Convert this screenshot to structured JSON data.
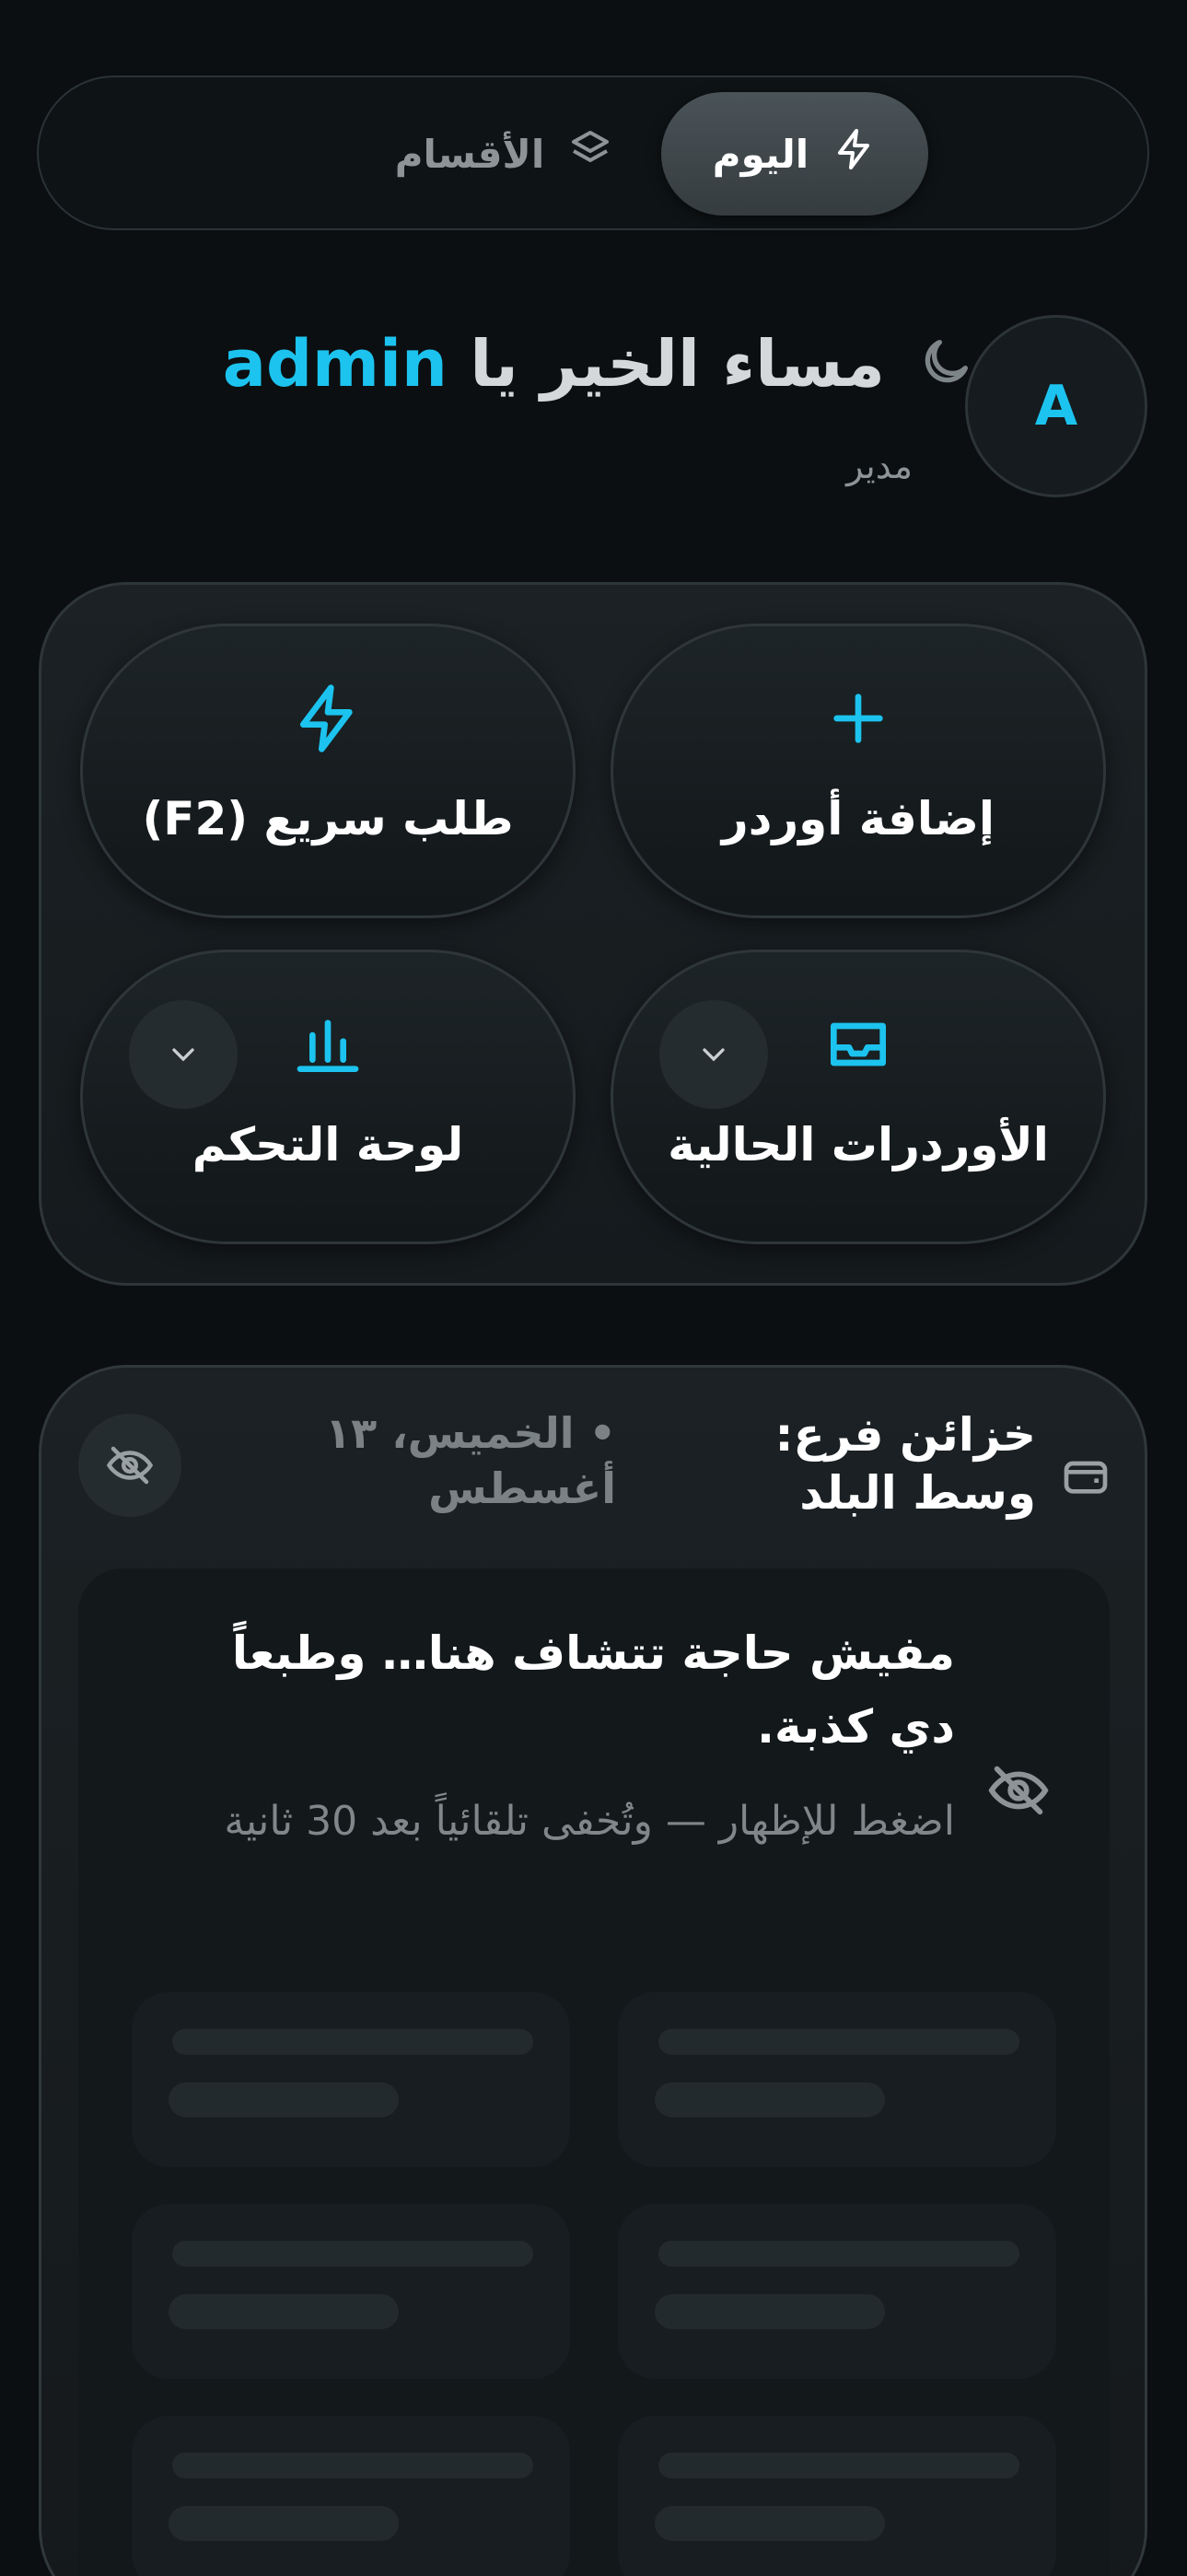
{
  "tabs": {
    "today_label": "اليوم",
    "today_icon": "bolt-icon",
    "sections_label": "الأقسام",
    "sections_icon": "layers-icon"
  },
  "header": {
    "greeting": "مساء الخير يا",
    "username": "admin",
    "role": "مدير",
    "avatar_letter": "A",
    "time_icon": "moon-icon"
  },
  "actions": [
    {
      "label": "إضافة أوردر",
      "icon": "plus-icon"
    },
    {
      "label": "طلب سريع (F2)",
      "icon": "bolt-icon"
    },
    {
      "label": "الأوردرات الحالية",
      "icon": "inbox-icon",
      "has_dropdown": true
    },
    {
      "label": "لوحة التحكم",
      "icon": "bar-chart-icon",
      "has_dropdown": true
    }
  ],
  "treasury": {
    "title": "خزائن فرع: وسط البلد",
    "date": "• الخميس، ١٣ أغسطس",
    "icon": "wallet-icon",
    "toggle_icon": "eye-off-icon",
    "message": "مفيش حاجة تتشاف هنا… وطبعاً دي كذبة.",
    "hint": "اضغط للإظهار — وتُخفى تلقائياً بعد 30 ثانية"
  },
  "colors": {
    "accent": "#1cc3ef",
    "background": "#0b0f11",
    "muted_text": "#8d9497"
  }
}
